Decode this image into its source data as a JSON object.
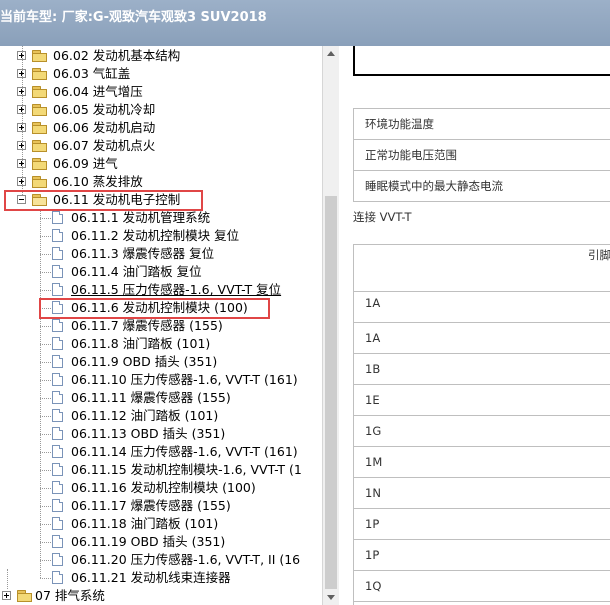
{
  "window": {
    "title": "当前车型:  厂家:G-观致汽车观致3 SUV2018"
  },
  "tree": {
    "items": [
      {
        "label": "06.02 发动机基本结构",
        "type": "folder",
        "expander": "plus"
      },
      {
        "label": "06.03 气缸盖",
        "type": "folder",
        "expander": "plus"
      },
      {
        "label": "06.04 进气增压",
        "type": "folder",
        "expander": "plus"
      },
      {
        "label": "06.05 发动机冷却",
        "type": "folder",
        "expander": "plus"
      },
      {
        "label": "06.06 发动机启动",
        "type": "folder",
        "expander": "plus"
      },
      {
        "label": "06.07 发动机点火",
        "type": "folder",
        "expander": "plus"
      },
      {
        "label": "06.09 进气",
        "type": "folder",
        "expander": "plus"
      },
      {
        "label": "06.10 蒸发排放",
        "type": "folder",
        "expander": "plus"
      },
      {
        "label": "06.11 发动机电子控制",
        "type": "folder-open",
        "expander": "minus"
      },
      {
        "label": "06.11.1 发动机管理系统",
        "type": "doc"
      },
      {
        "label": "06.11.2 发动机控制模块 复位",
        "type": "doc"
      },
      {
        "label": "06.11.3 爆震传感器 复位",
        "type": "doc"
      },
      {
        "label": "06.11.4 油门踏板 复位",
        "type": "doc"
      },
      {
        "label": "06.11.5 压力传感器-1.6, VVT-T 复位",
        "type": "doc"
      },
      {
        "label": "06.11.6 发动机控制模块 (100)",
        "type": "doc"
      },
      {
        "label": "06.11.7 爆震传感器 (155)",
        "type": "doc"
      },
      {
        "label": "06.11.8 油门踏板 (101)",
        "type": "doc"
      },
      {
        "label": "06.11.9 OBD 插头 (351)",
        "type": "doc"
      },
      {
        "label": "06.11.10 压力传感器-1.6, VVT-T (161)",
        "type": "doc"
      },
      {
        "label": "06.11.11 爆震传感器 (155)",
        "type": "doc"
      },
      {
        "label": "06.11.12 油门踏板 (101)",
        "type": "doc"
      },
      {
        "label": "06.11.13 OBD 插头 (351)",
        "type": "doc"
      },
      {
        "label": "06.11.14 压力传感器-1.6, VVT-T (161)",
        "type": "doc"
      },
      {
        "label": "06.11.15 发动机控制模块-1.6, VVT-T (1",
        "type": "doc"
      },
      {
        "label": "06.11.16 发动机控制模块 (100)",
        "type": "doc"
      },
      {
        "label": "06.11.17 爆震传感器 (155)",
        "type": "doc"
      },
      {
        "label": "06.11.18 油门踏板 (101)",
        "type": "doc"
      },
      {
        "label": "06.11.19 OBD 插头 (351)",
        "type": "doc"
      },
      {
        "label": "06.11.20 压力传感器-1.6, VVT-T, II (16",
        "type": "doc"
      },
      {
        "label": "06.11.21 发动机线束连接器",
        "type": "doc"
      },
      {
        "label": "07 排气系统",
        "type": "folder",
        "expander": "plus"
      }
    ]
  },
  "params": [
    "环境功能温度",
    "正常功能电压范围",
    "睡眠模式中的最大静态电流"
  ],
  "connector_label": "连接 VVT-T",
  "pin_table": {
    "header": "引脚",
    "pins": [
      "1A",
      "1A",
      "1B",
      "1E",
      "1G",
      "1M",
      "1N",
      "1P",
      "1P",
      "1Q"
    ]
  }
}
